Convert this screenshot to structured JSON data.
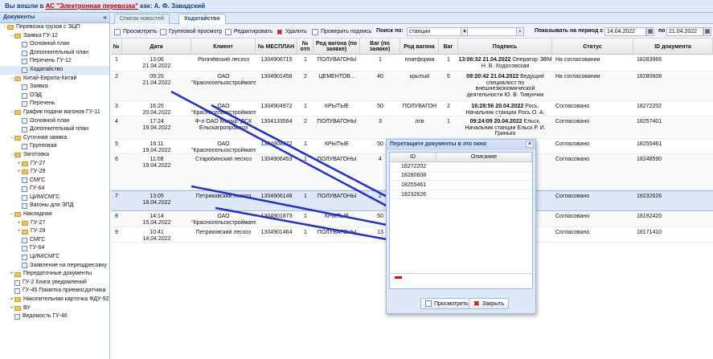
{
  "topbar": {
    "prefix": "Вы вошли в",
    "system_link": "АС \"Электронная перевозка\"",
    "user_label": "как: А. Ф. Завадский"
  },
  "sidebar": {
    "title": "Документы",
    "collapse_icon": "«",
    "items": [
      {
        "label": "Перевозка грузов с ЭЦП",
        "level": 0,
        "kind": "folder",
        "twist": "−"
      },
      {
        "label": "Заявка ГУ-12",
        "level": 1,
        "kind": "folder",
        "twist": "−"
      },
      {
        "label": "Основной план",
        "level": 2,
        "kind": "leaf",
        "twist": ""
      },
      {
        "label": "Дополнительный план",
        "level": 2,
        "kind": "leaf",
        "twist": ""
      },
      {
        "label": "Перечень ГУ-12",
        "level": 2,
        "kind": "leaf",
        "twist": ""
      },
      {
        "label": "Ходатайство",
        "level": 2,
        "kind": "leaf",
        "twist": "",
        "selected": true
      },
      {
        "label": "Китай-Европа-Китай",
        "level": 1,
        "kind": "folder",
        "twist": "−"
      },
      {
        "label": "Заявка",
        "level": 2,
        "kind": "leaf",
        "twist": ""
      },
      {
        "label": "ОЭД",
        "level": 2,
        "kind": "leaf",
        "twist": ""
      },
      {
        "label": "Перечень",
        "level": 2,
        "kind": "leaf",
        "twist": ""
      },
      {
        "label": "График подачи вагонов ГУ-11",
        "level": 1,
        "kind": "folder",
        "twist": "−"
      },
      {
        "label": "Основной план",
        "level": 2,
        "kind": "leaf",
        "twist": ""
      },
      {
        "label": "Дополнительный план",
        "level": 2,
        "kind": "leaf",
        "twist": ""
      },
      {
        "label": "Суточная заявка",
        "level": 1,
        "kind": "folder",
        "twist": "−"
      },
      {
        "label": "Групповая",
        "level": 2,
        "kind": "leaf",
        "twist": ""
      },
      {
        "label": "Заготовка",
        "level": 1,
        "kind": "folder",
        "twist": "−"
      },
      {
        "label": "ГУ-27",
        "level": 2,
        "kind": "folder",
        "twist": "+"
      },
      {
        "label": "ГУ-29",
        "level": 2,
        "kind": "folder",
        "twist": "+"
      },
      {
        "label": "СМГС",
        "level": 2,
        "kind": "leaf",
        "twist": ""
      },
      {
        "label": "ГУ-64",
        "level": 2,
        "kind": "leaf",
        "twist": ""
      },
      {
        "label": "ЦИМ/СМГС",
        "level": 2,
        "kind": "leaf",
        "twist": ""
      },
      {
        "label": "Вагоны для ЭПД",
        "level": 2,
        "kind": "leaf",
        "twist": ""
      },
      {
        "label": "Накладная",
        "level": 1,
        "kind": "folder",
        "twist": "−"
      },
      {
        "label": "ГУ-27",
        "level": 2,
        "kind": "folder",
        "twist": "+"
      },
      {
        "label": "ГУ-29",
        "level": 2,
        "kind": "folder",
        "twist": "+"
      },
      {
        "label": "СМГС",
        "level": 2,
        "kind": "leaf",
        "twist": ""
      },
      {
        "label": "ГУ-64",
        "level": 2,
        "kind": "leaf",
        "twist": ""
      },
      {
        "label": "ЦИМ/СМГС",
        "level": 2,
        "kind": "leaf",
        "twist": ""
      },
      {
        "label": "Заявление на переадресовку",
        "level": 2,
        "kind": "leaf",
        "twist": ""
      },
      {
        "label": "Передаточные документы",
        "level": 1,
        "kind": "folder",
        "twist": "+"
      },
      {
        "label": "ГУ-2 Книга уведомлений",
        "level": 1,
        "kind": "leaf",
        "twist": ""
      },
      {
        "label": "ГУ-45 Памятка приемосдатчика",
        "level": 1,
        "kind": "leaf",
        "twist": ""
      },
      {
        "label": "Накопительная карточка ФДУ-92",
        "level": 1,
        "kind": "folder",
        "twist": "+"
      },
      {
        "label": "ВУ",
        "level": 1,
        "kind": "folder",
        "twist": "+"
      },
      {
        "label": "Ведомость ГУ-46",
        "level": 1,
        "kind": "leaf",
        "twist": ""
      }
    ]
  },
  "tabs": [
    {
      "label": "Список новостей",
      "active": false
    },
    {
      "label": "Ходатайство",
      "active": true
    }
  ],
  "toolbar": {
    "view_label": "Просмотреть",
    "group_view_label": "Групповой просмотр",
    "edit_label": "Редактировать",
    "delete_label": "Удалить",
    "check_sign_label": "Проверить подпись",
    "search_label": "Поиск по:",
    "search_field_value": "станции",
    "search_value": "",
    "period_label": "Показывать на период с",
    "date_from": "14.04.2022",
    "to_label": "по",
    "date_to": "21.04.2022",
    "dropdown_glyph": "▾",
    "search_glyph": "⌕",
    "calendar_glyph": "▦"
  },
  "grid": {
    "columns": [
      "№",
      "Дата",
      "Клиент",
      "№ МЕСПЛАН",
      "№ отп",
      "Род вагона (по заявке)",
      "Ваг (по заявке)",
      "Род вагона",
      "Ваг",
      "Подпись",
      "Статус",
      "ID документа"
    ],
    "rows": [
      {
        "n": "1",
        "date": "13:06\n21.04.2022",
        "client": "Рогачёвский лесхоз",
        "plan": "1304906715",
        "otp": "1",
        "type_req": "ПОЛУВАГОНЫ",
        "cnt_req": "1",
        "type": "платформа",
        "cnt": "1",
        "sign_bold": "13:06:32 21.04.2022",
        "sign": " Оператор ЭВМ Н. В. Ходосовская",
        "status": "На согласовании",
        "id": "18283966"
      },
      {
        "n": "2",
        "date": "09:20\n21.04.2022",
        "client": "ОАО\n\"Красносельскстройматери...",
        "plan": "1304901458",
        "otp": "2",
        "type_req": "ЦЕМЕНТОВ...",
        "cnt_req": "40",
        "type": "крытый",
        "cnt": "5",
        "sign_bold": "09:20:42 21.04.2022",
        "sign": " Ведущий специалист по внешнеэкономической деятельности Ю. В. Тивунчик",
        "status": "На согласовании",
        "id": "18280608"
      },
      {
        "n": "3",
        "date": "16:25\n20.04.2022",
        "client": "ОАО\n\"Красносельскстройматери...",
        "plan": "1304904972",
        "otp": "1",
        "type_req": "КРЫТЫЕ",
        "cnt_req": "50",
        "type": "ПОЛУВАГОН",
        "cnt": "2",
        "sign_bold": "16:28:56 20.04.2022",
        "sign": " Рось, Начальник станции Рось О. А. Ходак",
        "status": "Согласовано",
        "id": "18272202"
      },
      {
        "n": "4",
        "date": "17:24\n19.04.2022",
        "client": "Ф-л ОАО Мозыр. ДСК\nЕльскагропромхоз",
        "plan": "1304133564",
        "otp": "2",
        "type_req": "ПОЛУВАГОНЫ",
        "cnt_req": "3",
        "type": "лсв",
        "cnt": "1",
        "sign_bold": "09:24:09 20.04.2022",
        "sign": " Ельск, Начальник станции Ельск Р. И. Гринько",
        "status": "Согласовано",
        "id": "18257401"
      },
      {
        "n": "5",
        "date": "16:11\n19.04.2022",
        "client": "ОАО\n\"Красносельскстройматери...",
        "plan": "1304904972",
        "otp": "1",
        "type_req": "КРЫТЫЕ",
        "cnt_req": "50",
        "type": "",
        "cnt": "",
        "sign_bold": "",
        "sign": "",
        "status": "Согласовано",
        "id": "18255461"
      },
      {
        "n": "6",
        "date": "11:08\n19.04.2022",
        "client": "Старобинский лесхоз",
        "plan": "1304906453",
        "otp": "1",
        "type_req": "ПОЛУВАГОНЫ",
        "cnt_req": "4",
        "type": "",
        "cnt": "",
        "sign_bold": "",
        "sign": "",
        "status": "Согласовано",
        "id": "18248590"
      },
      {
        "n": "7",
        "date": "13:05\n18.04.2022",
        "client": "Петриковский лесхоз",
        "plan": "1304906148",
        "otp": "1",
        "type_req": "ПОЛУВАГОНЫ",
        "cnt_req": "2",
        "type": "",
        "cnt": "",
        "sign_bold": "",
        "sign": "",
        "status": "Согласовано",
        "id": "18232626"
      },
      {
        "n": "8",
        "date": "14:14\n15.04.2022",
        "client": "ОАО\n\"Красносельскстройматери...",
        "plan": "1304901873",
        "otp": "1",
        "type_req": "КРЫТЫЕ",
        "cnt_req": "50",
        "type": "",
        "cnt": "",
        "sign_bold": "",
        "sign": "",
        "status": "Согласовано",
        "id": "18192420"
      },
      {
        "n": "9",
        "date": "10:41\n14.04.2022",
        "client": "Петриковский лесхоз",
        "plan": "1304901464",
        "otp": "1",
        "type_req": "ПОЛУВАГОНЫ",
        "cnt_req": "13",
        "type": "",
        "cnt": "",
        "sign_bold": "",
        "sign": "",
        "status": "Согласовано",
        "id": "18171410"
      }
    ]
  },
  "dialog": {
    "title": "Перетащите документы в это окно",
    "close_glyph": "×",
    "col_id": "ID",
    "col_desc": "Описание",
    "rows": [
      "18272202",
      "18280608",
      "18255461",
      "18232626"
    ],
    "view_label": "Просмотреть",
    "close_label": "Закрыть"
  },
  "colors": {
    "accent": "#15428b",
    "arrow": "#1f2fd6",
    "panel_bg": "#dfe8f6",
    "border": "#99bbe8"
  }
}
